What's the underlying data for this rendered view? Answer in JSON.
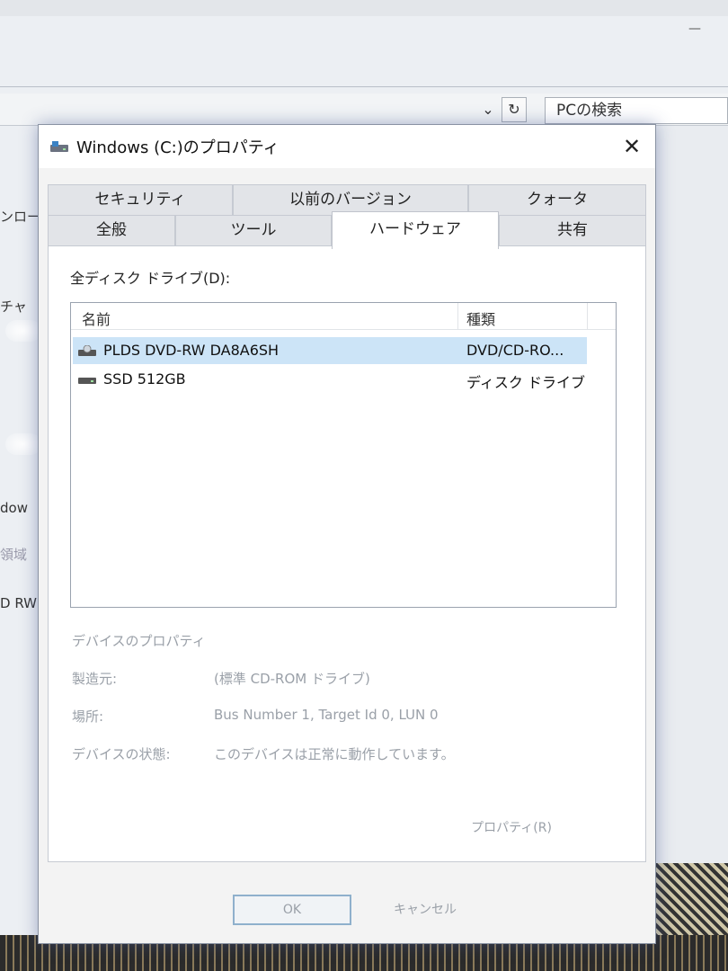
{
  "background": {
    "search_text": "PCの検索",
    "left_fragments": [
      "ンロー",
      "チャ",
      "dow",
      "領域",
      "D RW"
    ]
  },
  "dialog": {
    "title": "Windows (C:)のプロパティ",
    "close_glyph": "✕",
    "tabs_row1": [
      "セキュリティ",
      "以前のバージョン",
      "クォータ"
    ],
    "tabs_row2": [
      "全般",
      "ツール",
      "ハードウェア",
      "共有"
    ],
    "active_tab": "ハードウェア"
  },
  "hardware": {
    "all_disks_label": "全ディスク ドライブ(D):",
    "columns": {
      "name": "名前",
      "type": "種類"
    },
    "rows": [
      {
        "name": "PLDS DVD-RW DA8A6SH",
        "type": "DVD/CD-RO...",
        "icon": "dvd-drive-icon",
        "selected": true
      },
      {
        "name": "SSD 512GB",
        "type": "ディスク ドライブ",
        "icon": "disk-drive-icon",
        "selected": false
      }
    ],
    "device_properties": {
      "title": "デバイスのプロパティ",
      "manufacturer_label": "製造元:",
      "manufacturer_value": "(標準 CD-ROM ドライブ)",
      "location_label": "場所:",
      "location_value": "Bus Number 1, Target Id 0, LUN 0",
      "status_label": "デバイスの状態:",
      "status_value": "このデバイスは正常に動作しています。"
    },
    "properties_button": "プロパティ(R)"
  },
  "buttons": {
    "ok": "OK",
    "cancel": "キャンセル"
  },
  "colors": {
    "selection": "#cce4f7",
    "disabled_text": "#9aa0a8",
    "ok_border": "#8fb0cc"
  }
}
